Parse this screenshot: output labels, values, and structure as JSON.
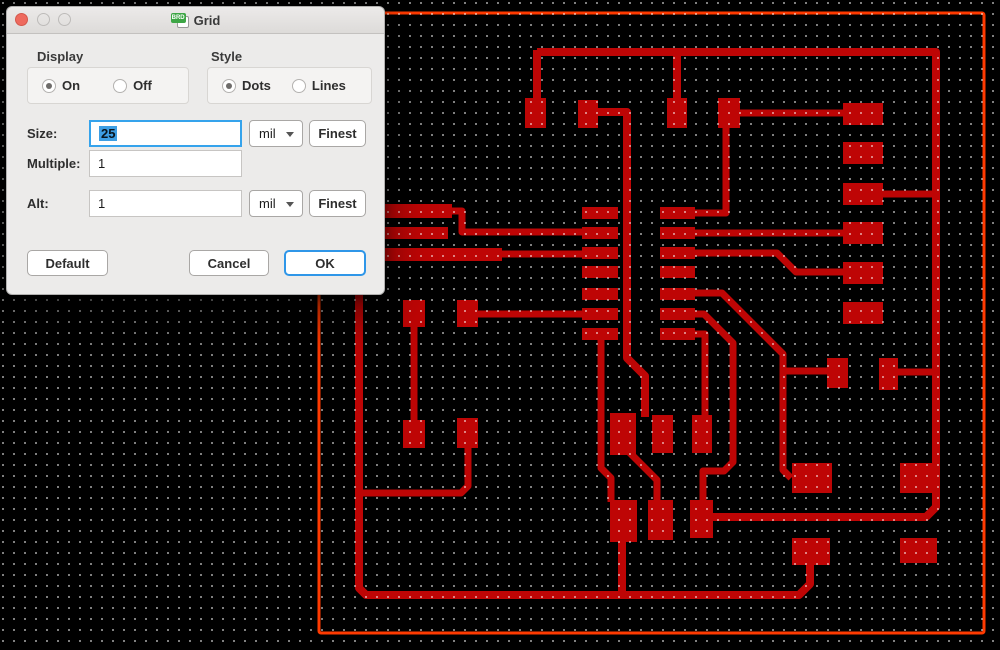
{
  "window": {
    "title": "Grid",
    "icon": "brd-document-icon",
    "traffic_lights": [
      "close",
      "minimize-disabled",
      "zoom-disabled"
    ]
  },
  "dialog": {
    "display": {
      "label": "Display",
      "options": [
        "On",
        "Off"
      ],
      "selected": "On"
    },
    "style": {
      "label": "Style",
      "options": [
        "Dots",
        "Lines"
      ],
      "selected": "Dots"
    },
    "size": {
      "label": "Size:",
      "value": "25",
      "unit": "mil",
      "finest_label": "Finest"
    },
    "multiple": {
      "label": "Multiple:",
      "value": "1"
    },
    "alt": {
      "label": "Alt:",
      "value": "1",
      "unit": "mil",
      "finest_label": "Finest"
    },
    "buttons": {
      "default": "Default",
      "cancel": "Cancel",
      "ok": "OK"
    }
  },
  "pcb": {
    "grid_spacing_px": 11,
    "grid_style": "dots"
  },
  "colors": {
    "pcb_background": "#000000",
    "copper": "#BE0505",
    "board_outline": "#FF3A00",
    "grid_dot": "rgba(255,255,255,0.5)",
    "accent_focus": "#35A3EC",
    "selection": "#3E9EE3",
    "close_button": "#EE6A5E"
  }
}
